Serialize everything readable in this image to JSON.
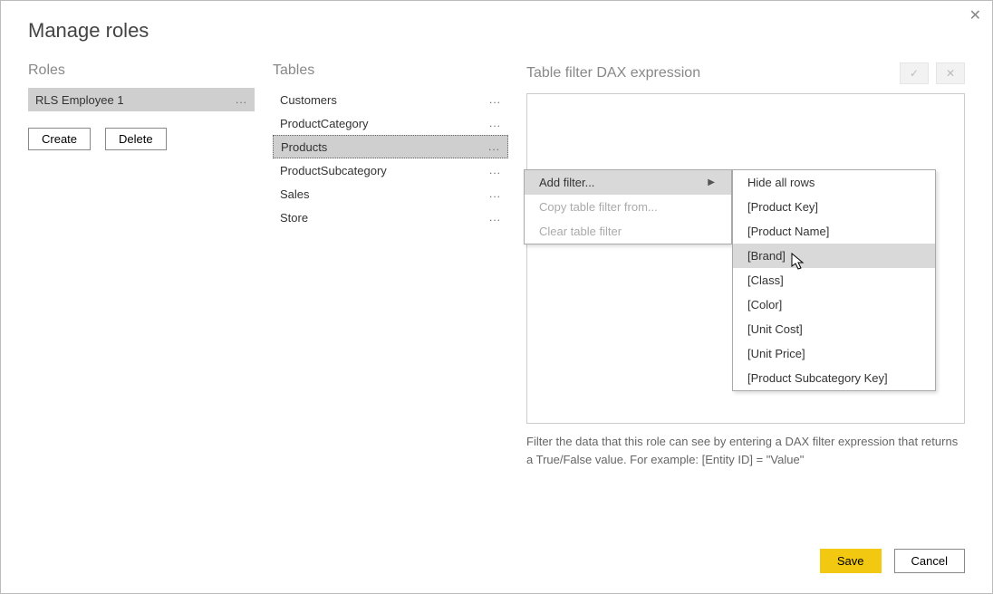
{
  "dialog": {
    "title": "Manage roles"
  },
  "roles": {
    "header": "Roles",
    "items": [
      {
        "label": "RLS Employee 1"
      }
    ],
    "create_label": "Create",
    "delete_label": "Delete"
  },
  "tables": {
    "header": "Tables",
    "items": [
      {
        "label": "Customers"
      },
      {
        "label": "ProductCategory"
      },
      {
        "label": "Products"
      },
      {
        "label": "ProductSubcategory"
      },
      {
        "label": "Sales"
      },
      {
        "label": "Store"
      }
    ]
  },
  "expression": {
    "header": "Table filter DAX expression",
    "hint": "Filter the data that this role can see by entering a DAX filter expression that returns a True/False value. For example: [Entity ID] = \"Value\""
  },
  "context_menu_1": {
    "add_filter": "Add filter...",
    "copy_from": "Copy table filter from...",
    "clear": "Clear table filter"
  },
  "context_menu_2": {
    "items": [
      "Hide all rows",
      "[Product Key]",
      "[Product Name]",
      "[Brand]",
      "[Class]",
      "[Color]",
      "[Unit Cost]",
      "[Unit Price]",
      "[Product Subcategory Key]"
    ]
  },
  "buttons": {
    "save": "Save",
    "cancel": "Cancel"
  },
  "icons": {
    "check": "✓",
    "x": "✕",
    "close": "✕",
    "dots": "...",
    "arrow_right": "▶"
  }
}
